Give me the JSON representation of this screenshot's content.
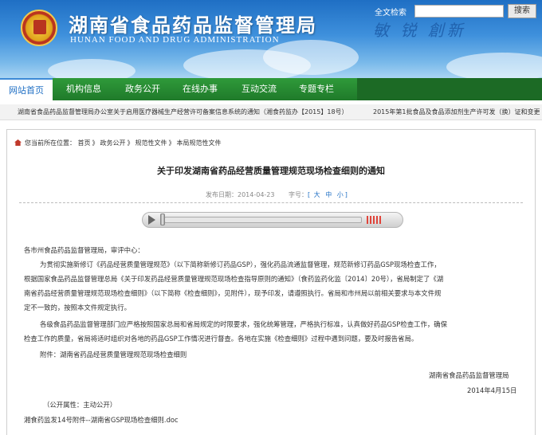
{
  "header": {
    "title": "湖南省食品药品监督管理局",
    "subtitle": "HUNAN FOOD AND DRUG ADMINISTRATION",
    "slogan": "敏 锐 創新"
  },
  "nav": {
    "items": [
      {
        "label": "网站首页"
      },
      {
        "label": "机构信息"
      },
      {
        "label": "政务公开"
      },
      {
        "label": "在线办事"
      },
      {
        "label": "互动交流"
      },
      {
        "label": "专题专栏"
      }
    ],
    "search_label": "全文检索",
    "search_value": "",
    "search_button": "搜索"
  },
  "ticker": {
    "items": [
      "湖南省食品药品监督管理局办公室关于启用医疗器械生产经营许可备案信息系统的通知（湘食药监办【2015】18号）",
      "2015年第1批食品及食品添加剂生产许可发（换）证和变更"
    ]
  },
  "breadcrumb": {
    "prefix": "您当前所在位置：",
    "items": [
      "首页",
      "政务公开",
      "规范性文件",
      "本局规范性文件"
    ],
    "sep": "》"
  },
  "document": {
    "title": "关于印发湖南省药品经营质量管理规范现场检查细则的通知",
    "publish_label": "发布日期：2014-04-23",
    "fontsize_label": "字号：",
    "font_large": "大",
    "font_medium": "中",
    "font_small": "小",
    "bracket_open": "[",
    "bracket_close": "]",
    "salutation": "各市州食品药品监督管理局，审评中心：",
    "p1_l1": "为贯彻实施新修订《药品经营质量管理规范》（以下简称新修订药品GSP），强化药品流通监督管理，规范新修订药品GSP现场检查工作，",
    "p1_l2": "根据国家食品药品监督管理总局《关于印发药品经营质量管理规范现场检查指导原则的通知》（食药监药化监〔2014〕20号），省局制定了《湖",
    "p1_l3": "南省药品经营质量管理规范现场检查细则》（以下简称《检查细则》，见附件），现予印发，请遵照执行。省局和市州局以前相关要求与本文件规",
    "p1_l4": "定不一致的，按照本文件规定执行。",
    "p2_l1": "各级食品药品监督管理部门应严格按照国家总局和省局规定的时限要求，强化统筹管理，严格执行标准，认真做好药品GSP检查工作，确保",
    "p2_l2": "检查工作的质量，省局将适时组织对各地的药品GSP工作情况进行督查。各地在实施《检查细则》过程中遇到问题，要及时报告省局。",
    "attachment": "附件：湖南省药品经营质量管理规范现场检查细则",
    "sign_org": "湖南省食品药品监督管理局",
    "sign_date": "2014年4月15日",
    "public_attr": "（公开属性：主动公开）",
    "attachment_file": "湘食药监发14号附件--湖南省GSP现场检查细则.doc"
  }
}
